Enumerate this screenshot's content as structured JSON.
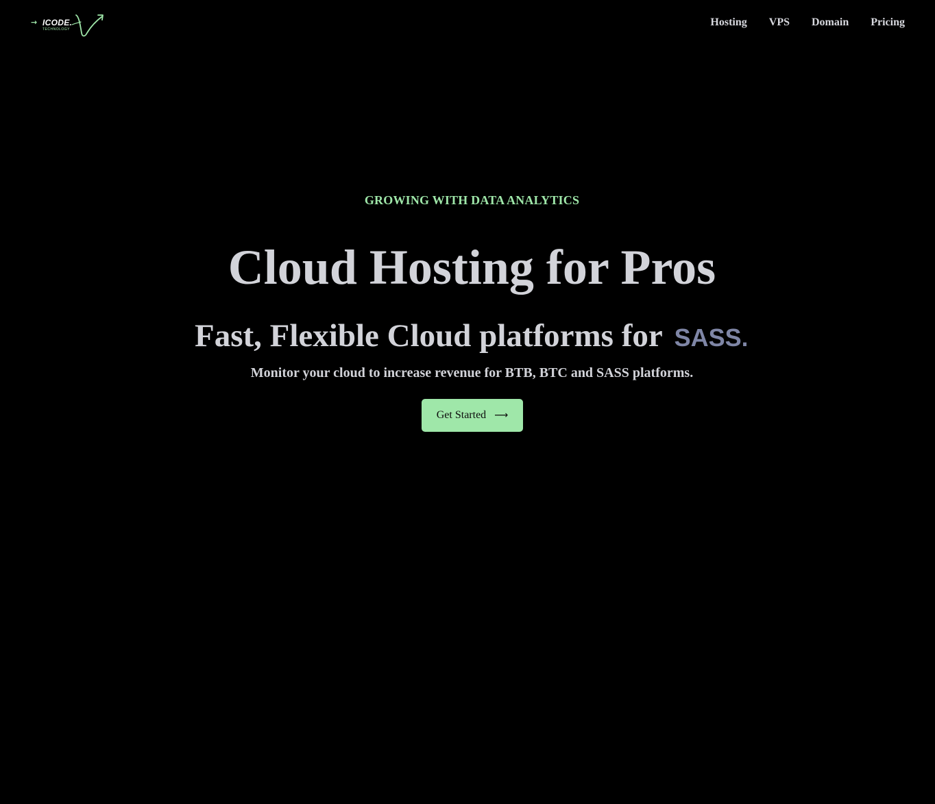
{
  "brand": {
    "name": "ICODE.",
    "tagline": "TECHNOLOGY",
    "accent_color": "#9fe7a9"
  },
  "nav": {
    "items": [
      {
        "label": "Hosting"
      },
      {
        "label": "VPS"
      },
      {
        "label": "Domain"
      },
      {
        "label": "Pricing"
      }
    ]
  },
  "hero": {
    "eyebrow": "GROWING WITH DATA ANALYTICS",
    "headline": "Cloud Hosting for Pros",
    "subline_prefix": "Fast, Flexible Cloud platforms for",
    "subline_accent": "SASS.",
    "description": "Monitor your cloud to increase revenue for BTB, BTC and SASS platforms.",
    "cta_label": "Get Started",
    "cta_icon": "arrow-right-icon"
  },
  "colors": {
    "background": "#000000",
    "text": "#d2d3d9",
    "accent": "#9fe7a9",
    "muted_accent": "#7f86a6"
  }
}
